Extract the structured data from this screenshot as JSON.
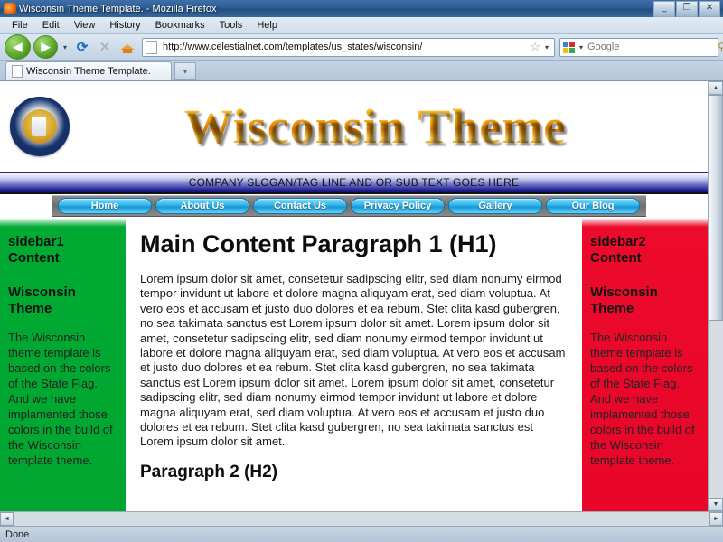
{
  "browser": {
    "window_title": "Wisconsin Theme Template. - Mozilla Firefox",
    "window_buttons": {
      "minimize": "_",
      "restore": "❐",
      "close": "✕"
    },
    "menu": [
      "File",
      "Edit",
      "View",
      "History",
      "Bookmarks",
      "Tools",
      "Help"
    ],
    "toolbar": {
      "back": "◀",
      "forward": "▶",
      "history_dropdown": "▾",
      "reload": "⟳",
      "stop": "✕",
      "home": "home-icon",
      "bookmark_star": "☆",
      "star_dropdown": "▾",
      "search_engine_dropdown": "▾",
      "search_go": "⚲"
    },
    "url": "http://www.celestialnet.com/templates/us_states/wisconsin/",
    "search_placeholder": "Google",
    "tab_title": "Wisconsin Theme Template.",
    "tab_list_button": "▾",
    "status_text": "Done",
    "scroll": {
      "up": "▲",
      "down": "▼",
      "left": "◄",
      "right": "►"
    }
  },
  "site": {
    "seal_alt": "wisconsin-state-seal",
    "wordmark": "Wisconsin Theme",
    "slogan": "COMPANY SLOGAN/TAG LINE AND OR SUB TEXT GOES HERE",
    "nav": [
      "Home",
      "About Us",
      "Contact Us",
      "Privacy Policy",
      "Gallery",
      "Our Blog"
    ],
    "sidebar1": {
      "heading": "sidebar1 Content",
      "subheading": "Wisconsin Theme",
      "body": "The Wisconsin theme template is based on the colors of the State Flag. And we have implamented those colors in the build of the Wisconsin template theme."
    },
    "sidebar2": {
      "heading": "sidebar2 Content",
      "subheading": "Wisconsin Theme",
      "body": "The Wisconsin theme template is based on the colors of the State Flag. And we have implamented those colors in the build of the Wisconsin template theme."
    },
    "main": {
      "h1": "Main Content Paragraph 1 (H1)",
      "p1": "Lorem ipsum dolor sit amet, consetetur sadipscing elitr, sed diam nonumy eirmod tempor invidunt ut labore et dolore magna aliquyam erat, sed diam voluptua. At vero eos et accusam et justo duo dolores et ea rebum. Stet clita kasd gubergren, no sea takimata sanctus est Lorem ipsum dolor sit amet. Lorem ipsum dolor sit amet, consetetur sadipscing elitr, sed diam nonumy eirmod tempor invidunt ut labore et dolore magna aliquyam erat, sed diam voluptua. At vero eos et accusam et justo duo dolores et ea rebum. Stet clita kasd gubergren, no sea takimata sanctus est Lorem ipsum dolor sit amet. Lorem ipsum dolor sit amet, consetetur sadipscing elitr, sed diam nonumy eirmod tempor invidunt ut labore et dolore magna aliquyam erat, sed diam voluptua. At vero eos et accusam et justo duo dolores et ea rebum. Stet clita kasd gubergren, no sea takimata sanctus est Lorem ipsum dolor sit amet.",
      "h2": "Paragraph 2 (H2)"
    }
  },
  "colors": {
    "sidebar1_green": "#00a62f",
    "sidebar2_red": "#e8062a",
    "nav_pill_blue": "#36b6ea",
    "wordmark_gold": "#f5a60d",
    "slogan_navy": "#1a1a8c"
  }
}
